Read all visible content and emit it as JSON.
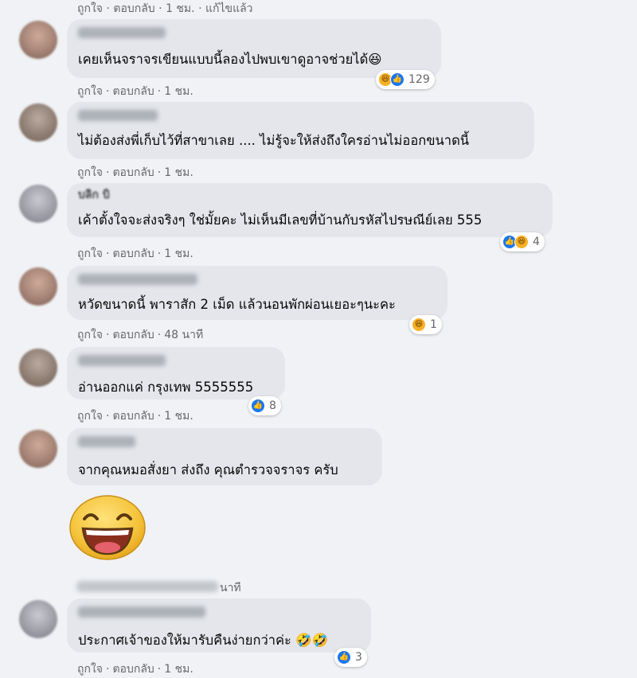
{
  "top_actions": {
    "like": "ถูกใจ",
    "reply": "ตอบกลับ",
    "time": "1 ชม.",
    "edited": "แก้ไขแล้ว"
  },
  "comments": [
    {
      "name": "",
      "text": "เคยเห็นจราจรเขียนแบบนี้ลองไปพบเขาดูอาจช่วยได้😆",
      "reactions": [
        "haha",
        "like"
      ],
      "count": "129",
      "like": "ถูกใจ",
      "reply": "ตอบกลับ",
      "time": "1 ชม."
    },
    {
      "name": "",
      "text": "ไม่ต้องส่งพี่เก็บไว้ที่สาขาเลย .... ไม่รู้จะให้ส่งถึงใครอ่านไม่ออกขนาดนี้",
      "reactions": [],
      "count": "",
      "like": "ถูกใจ",
      "reply": "ตอบกลับ",
      "time": "1 ชม."
    },
    {
      "name": "บลิก บิ",
      "text": "เค้าตั้งใจจะส่งจริงๆ ใช่มั้ยคะ ไม่เห็นมีเลขที่บ้านกับรหัสไปรษณีย์เลย 555",
      "reactions": [
        "like",
        "haha"
      ],
      "count": "4",
      "like": "ถูกใจ",
      "reply": "ตอบกลับ",
      "time": "1 ชม."
    },
    {
      "name": "",
      "text": "หวัดขนาดนี้ พาราสัก 2 เม็ด แล้วนอนพักผ่อนเยอะๆนะคะ",
      "reactions": [
        "haha"
      ],
      "count": "1",
      "like": "ถูกใจ",
      "reply": "ตอบกลับ",
      "time": "48 นาที"
    },
    {
      "name": "",
      "text": "อ่านออกแค่ กรุงเทพ 5555555",
      "reactions": [
        "like"
      ],
      "count": "8",
      "like": "ถูกใจ",
      "reply": "ตอบกลับ",
      "time": "1 ชม."
    },
    {
      "name": "",
      "text": "จากคุณหมอสั่งยา ส่งถึง คุณตำรวจจราจร ครับ",
      "reactions": [],
      "count": "",
      "like": "",
      "reply": "",
      "time": ""
    },
    {
      "name": "",
      "text": "",
      "reactions": [],
      "count": "",
      "like": "",
      "reply": "",
      "time": "นาที"
    },
    {
      "name": "",
      "text": "ประกาศเจ้าของให้มารับคืนง่ายกว่าค่ะ 🤣🤣",
      "reactions": [
        "like"
      ],
      "count": "3",
      "like": "ถูกใจ",
      "reply": "ตอบกลับ",
      "time": "1 ชม."
    }
  ],
  "colors": {
    "background": "#f0f2f5",
    "bubble": "#e4e6eb",
    "like_blue": "#1877f2",
    "haha_yellow": "#f7b125",
    "meta_gray": "#65676b"
  },
  "icons": {
    "like": "like-reaction-icon",
    "haha": "haha-reaction-icon",
    "sticker": "laughing-face-sticker"
  }
}
